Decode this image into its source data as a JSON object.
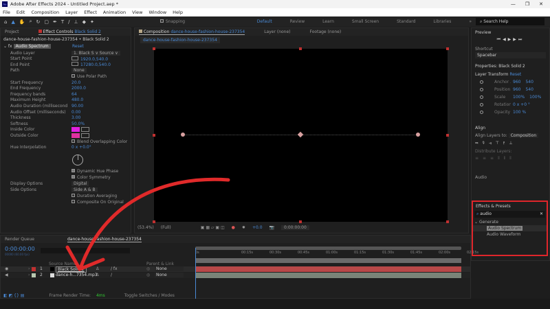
{
  "window": {
    "title": "Adobe After Effects 2024 - Untitled Project.aep *",
    "controls": [
      "—",
      "❐",
      "✕"
    ]
  },
  "menu": [
    "File",
    "Edit",
    "Composition",
    "Layer",
    "Effect",
    "Animation",
    "View",
    "Window",
    "Help"
  ],
  "toolbar": {
    "snapping": "Snapping",
    "workspaces": [
      "Default",
      "Review",
      "Learn",
      "Small Screen",
      "Standard",
      "Libraries"
    ],
    "more": "»",
    "search_placeholder": "Search Help"
  },
  "left_panel": {
    "tab_project": "Project",
    "tab_effect": "Effect Controls",
    "tab_effect_layer": "Black Solid 2",
    "breadcrumb": "dance-house-fashion-house-237354 • Black Solid 2",
    "effect_name": "Audio Spectrum",
    "reset": "Reset",
    "props": [
      {
        "label": "Audio Layer",
        "value": "1. Black S ∨  Source ∨",
        "kind": "dd"
      },
      {
        "label": "Start Point",
        "value": "1920.0,540.0",
        "kind": "point"
      },
      {
        "label": "End Point",
        "value": "17280.0,540.0",
        "kind": "point"
      },
      {
        "label": "Path",
        "value": "None",
        "kind": "dd"
      },
      {
        "label": "",
        "value": "Use Polar Path",
        "kind": "check"
      },
      {
        "label": "Start Frequency",
        "value": "20.0"
      },
      {
        "label": "End Frequency",
        "value": "2000.0"
      },
      {
        "label": "Frequency bands",
        "value": "64"
      },
      {
        "label": "Maximum Height",
        "value": "480.0"
      },
      {
        "label": "Audio Duration (millisecond",
        "value": "90.00"
      },
      {
        "label": "Audio Offset (milliseconds)",
        "value": "0.00"
      },
      {
        "label": "Thickness",
        "value": "3.00"
      },
      {
        "label": "Softness",
        "value": "50.0%"
      },
      {
        "label": "Inside Color",
        "value": "",
        "kind": "color",
        "color": "#e020e0"
      },
      {
        "label": "Outside Color",
        "value": "",
        "kind": "color",
        "color": "#e030a0"
      },
      {
        "label": "",
        "value": "Blend Overlapping Color",
        "kind": "check"
      },
      {
        "label": "Hue Interpolation",
        "value": "0 x +0.0°"
      }
    ],
    "props2": [
      {
        "label": "",
        "value": "Dynamic Hue Phase",
        "kind": "check",
        "checked": true
      },
      {
        "label": "",
        "value": "Color Symmetry",
        "kind": "check",
        "checked": true
      },
      {
        "label": "Display Options",
        "value": "Digital",
        "kind": "dd"
      },
      {
        "label": "Side Options",
        "value": "Side A & B",
        "kind": "dd"
      },
      {
        "label": "",
        "value": "Duration Averaging",
        "kind": "check"
      },
      {
        "label": "",
        "value": "Composite On Original",
        "kind": "check"
      }
    ]
  },
  "comp": {
    "tab": "Composition",
    "comp_name": "dance-house-fashion-house-237354",
    "layer": "Layer  (none)",
    "footage": "Footage  (none)",
    "subtab": "dance-house-fashion-house-237354",
    "zoom": "(53.4%)",
    "resolution": "(Full)",
    "exposure": "+0.0",
    "timecode": "0:00:00:00"
  },
  "right": {
    "preview": "Preview",
    "shortcut_label": "Shortcut",
    "shortcut": "Spacebar",
    "properties": "Properties: Black Solid 2",
    "layer_transform": "Layer Transform",
    "reset": "Reset",
    "transform": [
      {
        "label": "Anchor ...",
        "v1": "960",
        "v2": "540"
      },
      {
        "label": "Position",
        "v1": "960",
        "v2": "540"
      },
      {
        "label": "Scale",
        "v1": "100%",
        "v2": "100%"
      },
      {
        "label": "Rotation",
        "v1": "0 x +0 °",
        "v2": ""
      },
      {
        "label": "Opacity",
        "v1": "100 %",
        "v2": ""
      }
    ],
    "align": "Align",
    "align_to_label": "Align Layers to:",
    "align_to": "Composition",
    "distribute": "Distribute Layers:",
    "audio": "Audio",
    "effects": "Effects & Presets",
    "effects_search": "audio",
    "group": "Generate",
    "items": [
      "Audio Spectrum",
      "Audio Waveform"
    ],
    "highlight": "#e0262b"
  },
  "timeline": {
    "render_queue": "Render Queue",
    "tab": "dance-house-fashion-house-237354",
    "timecode": "0:00:00:00",
    "fps": "00000 (60.00 fps)",
    "col_source": "Source Name",
    "col_parent": "Parent & Link",
    "layers": [
      {
        "num": "1",
        "name": "Black Solid 2",
        "parent": "None",
        "color": "#c03030",
        "bar": "#b84848"
      },
      {
        "num": "2",
        "name": "dance-h...7354.mp3",
        "parent": "None",
        "color": "#b8c8b0",
        "bar": "#7a8478"
      }
    ],
    "ruler": [
      "0s",
      "00:15s",
      "00:30s",
      "00:45s",
      "01:00s",
      "01:15s",
      "01:30s",
      "01:45s",
      "02:00s",
      "02:15s"
    ],
    "frame_render_label": "Frame Render Time:",
    "frame_render": "4ms",
    "toggle": "Toggle Switches / Modes"
  },
  "annotation_color": "#e02a2a"
}
